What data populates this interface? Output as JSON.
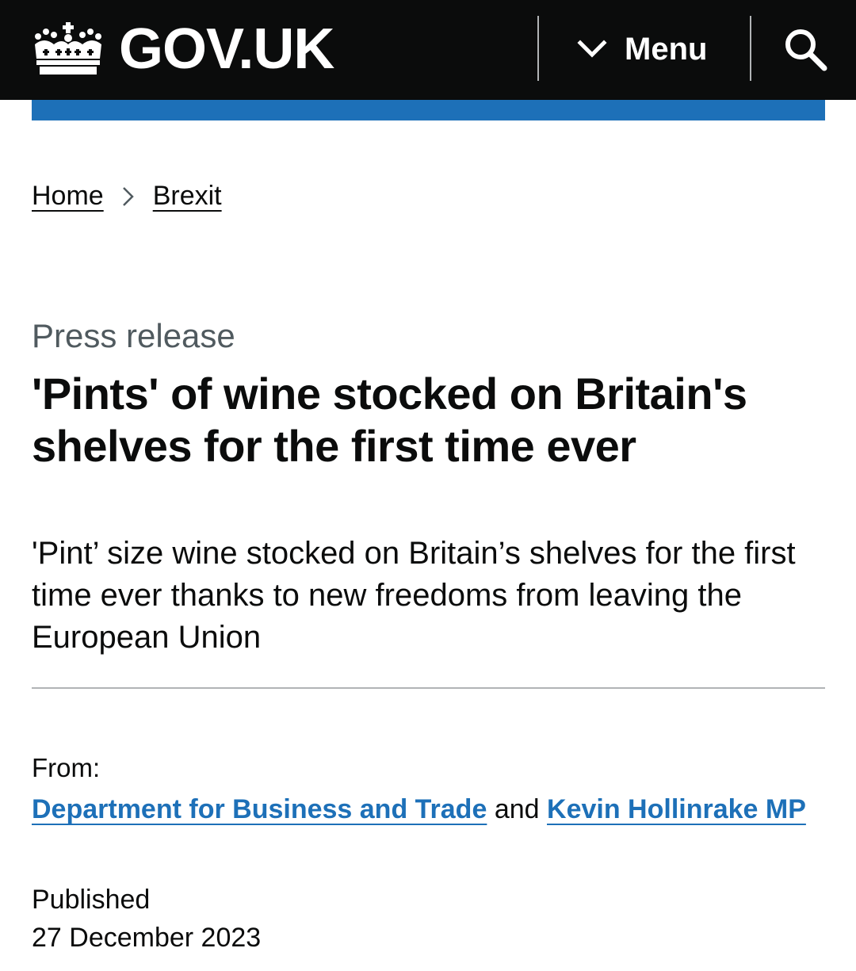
{
  "header": {
    "logo_text": "GOV.UK",
    "menu_label": "Menu",
    "colors": {
      "header_bg": "#0b0c0c",
      "accent_bar": "#1d70b8",
      "link": "#1d70b8"
    },
    "icons": {
      "logo": "crown-icon",
      "menu": "chevron-down-icon",
      "search": "search-icon"
    }
  },
  "breadcrumb": {
    "items": [
      {
        "label": "Home"
      },
      {
        "label": "Brexit"
      }
    ],
    "separator_icon": "chevron-right-icon"
  },
  "article": {
    "type_caption": "Press release",
    "title": "'Pints' of wine stocked on Britain's shelves for the first time ever",
    "lead": "'Pint’ size wine stocked on Britain’s shelves for the first time ever thanks to new freedoms from leaving the European Union"
  },
  "metadata": {
    "from_label": "From:",
    "organisations": [
      {
        "label": "Department for Business and Trade"
      },
      {
        "label": "Kevin Hollinrake MP"
      }
    ],
    "conjunction": "and",
    "published_label": "Published",
    "published_date": "27 December 2023"
  }
}
